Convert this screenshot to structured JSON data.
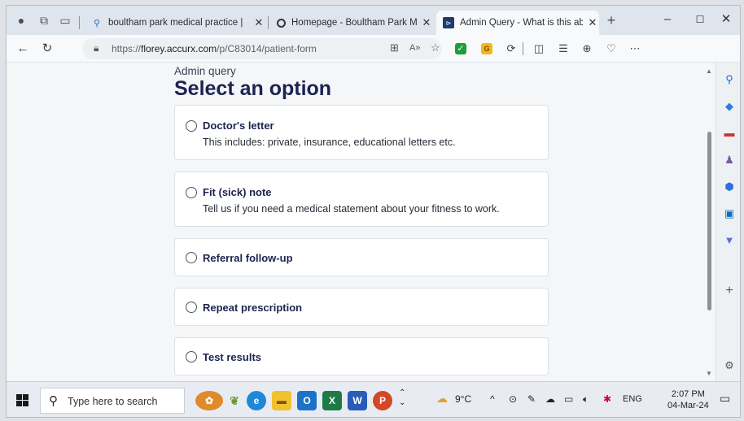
{
  "tabs": [
    {
      "label": "boultham park medical practice |",
      "icon": "search-icon"
    },
    {
      "label": "Homepage - Boultham Park Med",
      "icon": "loading-circle-icon"
    },
    {
      "label": "Admin Query - What is this abou",
      "icon": "accurx-icon"
    }
  ],
  "address": {
    "prefix": "https://",
    "domain": "florey.accurx.com",
    "path": "/p/C83014/patient-form"
  },
  "page": {
    "breadcrumb": "Admin query",
    "heading": "Select an option",
    "options": [
      {
        "title": "Doctor's letter",
        "description": "This includes: private, insurance, educational letters etc."
      },
      {
        "title": "Fit (sick) note",
        "description": "Tell us if you need a medical statement about your fitness to work."
      },
      {
        "title": "Referral follow-up",
        "description": ""
      },
      {
        "title": "Repeat prescription",
        "description": ""
      },
      {
        "title": "Test results",
        "description": ""
      }
    ]
  },
  "taskbar": {
    "search_placeholder": "Type here to search",
    "weather": "9°C",
    "language": "ENG",
    "time": "2:07 PM",
    "date": "04-Mar-24"
  },
  "colors": {
    "heading": "#1c2350",
    "tab_strip": "#dfe5ec",
    "page_bg": "#f4f6f8"
  }
}
